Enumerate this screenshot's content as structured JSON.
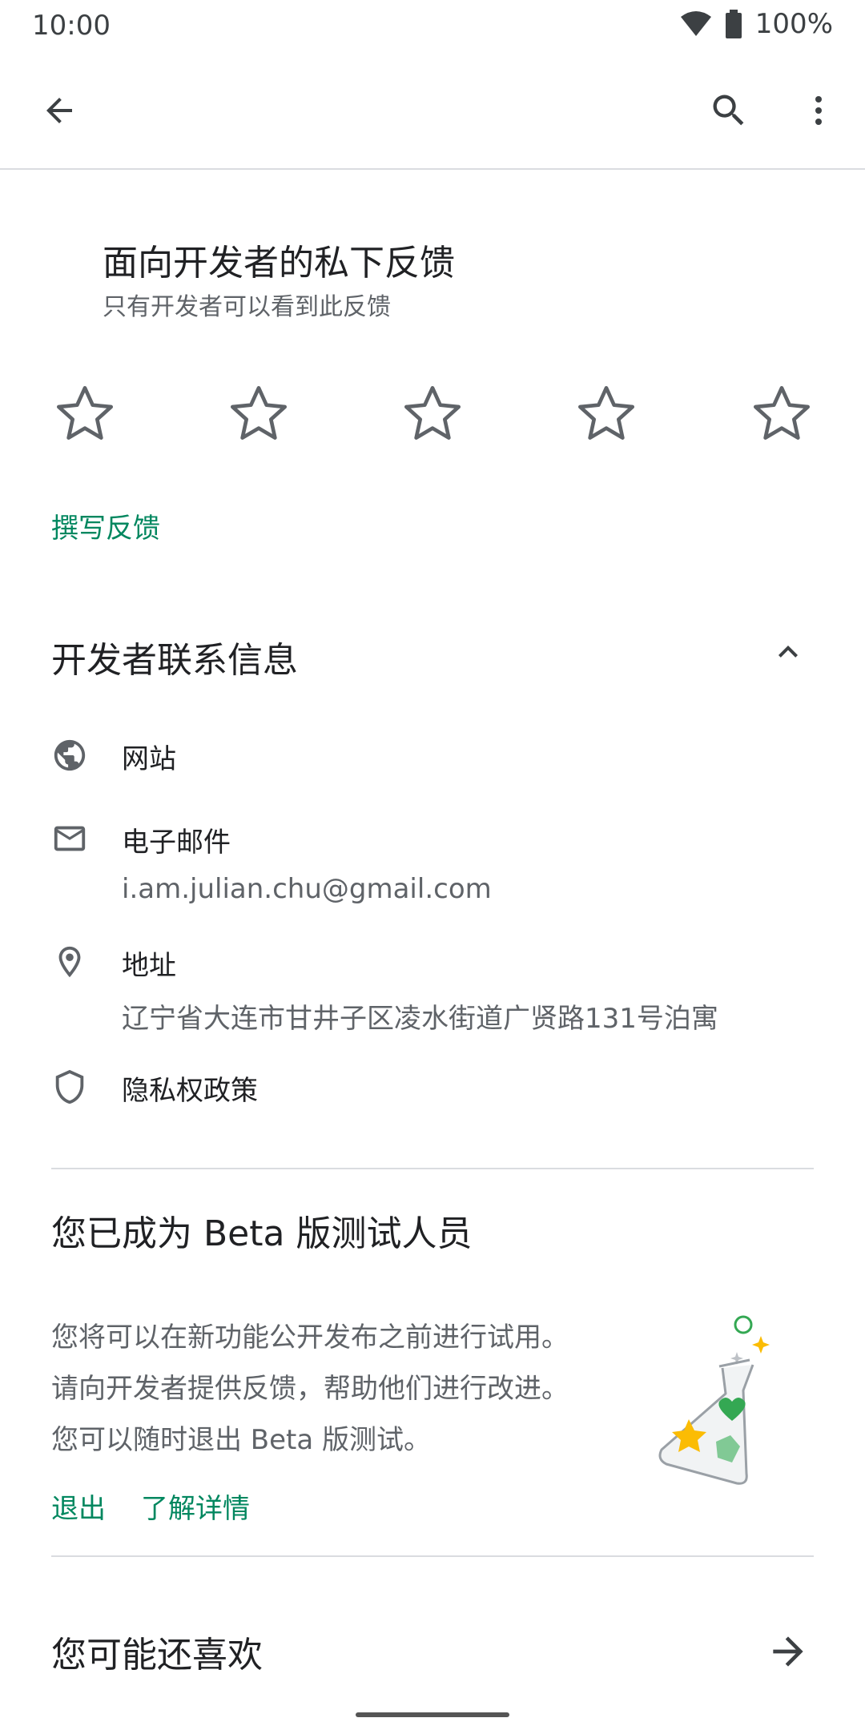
{
  "status_bar": {
    "time": "10:00",
    "battery": "100%",
    "icons": [
      "wifi-icon",
      "battery-icon"
    ]
  },
  "toolbar": {
    "icons": [
      "back-arrow-icon",
      "search-icon",
      "more-vert-icon"
    ]
  },
  "feedback": {
    "title": "面向开发者的私下反馈",
    "subtitle": "只有开发者可以看到此反馈",
    "rating": 0,
    "max_rating": 5,
    "write_link": "撰写反馈"
  },
  "developer_contact": {
    "title": "开发者联系信息",
    "website_label": "网站",
    "email_label": "电子邮件",
    "email_value": "i.am.julian.chu@gmail.com",
    "address_label": "地址",
    "address_value": "辽宁省大连市甘井子区凌水街道广贤路131号泊寓",
    "privacy_label": "隐私权政策"
  },
  "beta": {
    "title": "您已成为 Beta 版测试人员",
    "lines": [
      "您将可以在新功能公开发布之前进行试用。",
      "请向开发者提供反馈，帮助他们进行改进。",
      "您可以随时退出 Beta 版测试。"
    ],
    "leave_label": "退出",
    "learn_more_label": "了解详情"
  },
  "recommend": {
    "title": "您可能还喜欢"
  },
  "colors": {
    "accent": "#01875f",
    "text_primary": "#202124",
    "text_secondary": "#5f6368",
    "divider": "#dadce0",
    "icon": "#5f6368"
  }
}
